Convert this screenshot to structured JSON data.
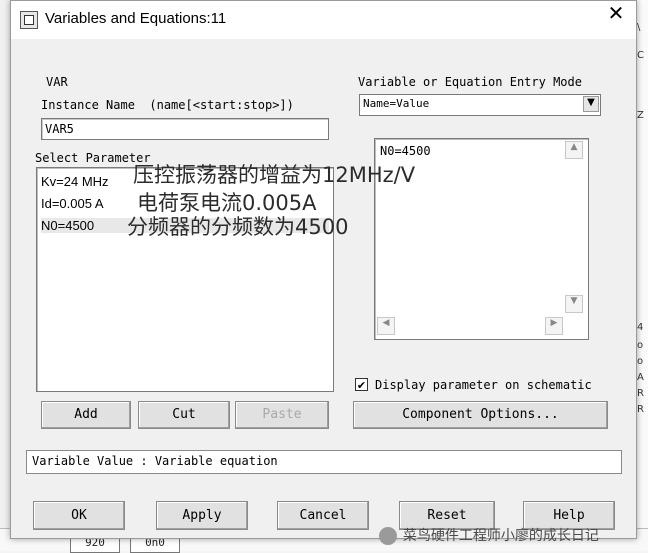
{
  "window": {
    "title": "Variables and Equations:11",
    "close_glyph": "✕"
  },
  "var_label": "VAR",
  "instance": {
    "label": "Instance Name  (name[<start:stop>])",
    "value": "VAR5"
  },
  "entry_mode": {
    "label": "Variable or Equation Entry Mode",
    "selected": "Name=Value"
  },
  "select_parameter": {
    "label": "Select Parameter",
    "items": [
      "Kv=24 MHz",
      "Id=0.005 A",
      "N0=4500"
    ]
  },
  "editor": {
    "value": "N0=4500"
  },
  "buttons": {
    "add": "Add",
    "cut": "Cut",
    "paste": "Paste",
    "component_options": "Component Options...",
    "ok": "OK",
    "apply": "Apply",
    "cancel": "Cancel",
    "reset": "Reset",
    "help": "Help"
  },
  "display_param": {
    "label": "Display parameter on schematic",
    "checked": true,
    "check_glyph": "✔"
  },
  "status": "Variable Value : Variable equation",
  "annotations": [
    "压控振荡器的增益为12MHz/V",
    "电荷泵电流0.005A",
    "分频器的分频数为4500"
  ],
  "watermark": "菜鸟硬件工程师小廖的成长日记",
  "background": {
    "right_marks": [
      "\\",
      "C",
      "Z",
      "4",
      "o",
      "o",
      "A",
      "R",
      "R"
    ],
    "bottom_cells": [
      "920",
      "0n0"
    ]
  },
  "colors": {
    "dialog_bg": "#f0f0f0",
    "title_bg": "#ffffff",
    "selected_item": "#e8e8e8"
  }
}
